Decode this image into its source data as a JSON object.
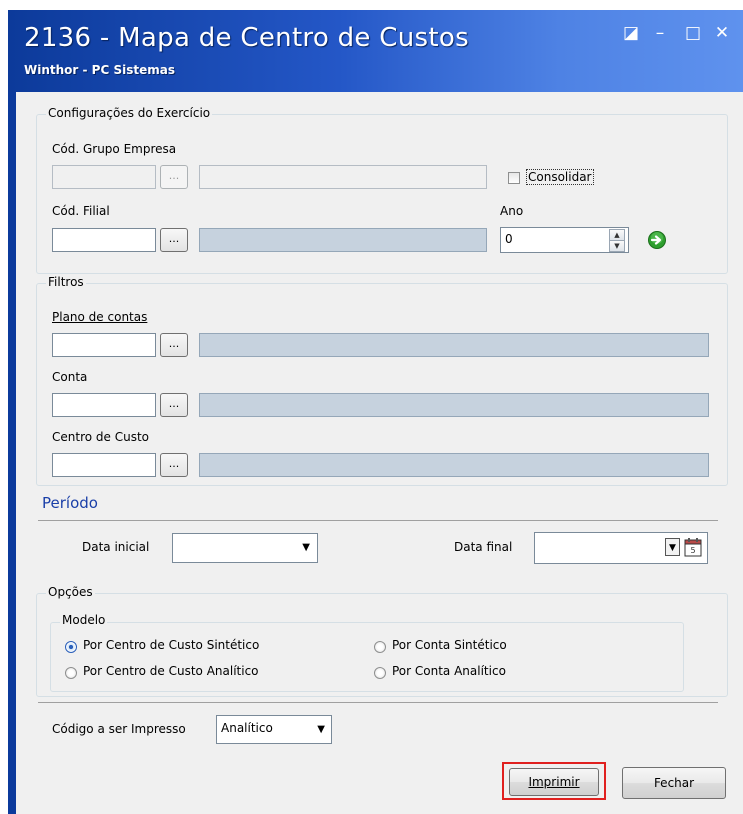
{
  "window": {
    "title": "2136 - Mapa de Centro de Custos",
    "subtitle": "Winthor - PC Sistemas",
    "controls": {
      "restore": "◪",
      "minimize": "–",
      "maximize": "□",
      "close": "✕"
    }
  },
  "config": {
    "group_label": "Configurações do Exercício",
    "grupo_empresa_label": "Cód. Grupo Empresa",
    "grupo_empresa_value": "",
    "consolidar_label": "Consolidar",
    "consolidar_checked": false,
    "filial_label": "Cód. Filial",
    "filial_value": "",
    "ano_label": "Ano",
    "ano_value": "0",
    "lookup_button": "..."
  },
  "filtros": {
    "group_label": "Filtros",
    "plano_label": "Plano de contas",
    "conta_label": "Conta",
    "centro_label": "Centro de Custo"
  },
  "periodo": {
    "heading": "Período",
    "data_inicial_label": "Data inicial",
    "data_inicial_value": "",
    "data_final_label": "Data final",
    "data_final_value": ""
  },
  "opcoes": {
    "group_label": "Opções",
    "modelo_label": "Modelo",
    "options": [
      {
        "label": "Por Centro de Custo Sintético",
        "selected": true
      },
      {
        "label": "Por Conta Sintético",
        "selected": false
      },
      {
        "label": "Por Centro de Custo Analítico",
        "selected": false
      },
      {
        "label": "Por Conta Analítico",
        "selected": false
      }
    ]
  },
  "codigo": {
    "label": "Código a ser Impresso",
    "value": "Analítico"
  },
  "buttons": {
    "imprimir": "Imprimir",
    "fechar": "Fechar"
  },
  "colors": {
    "title_bar": "#0c3a9a",
    "highlight": "#e0201f",
    "periodo_heading": "#1a3fa8",
    "readonly_field": "#c6d2de"
  },
  "icons": {
    "go": "green-arrow-right-icon",
    "calendar": "calendar-icon"
  }
}
